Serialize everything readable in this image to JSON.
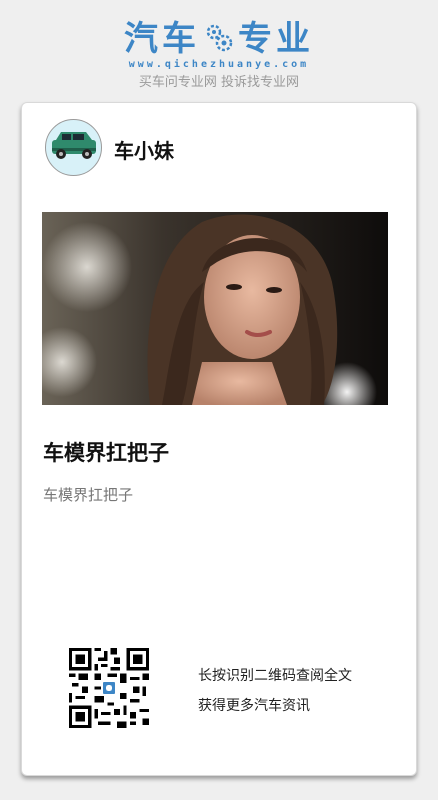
{
  "brand": {
    "title_left": "汽车",
    "title_right": "专业",
    "url": "www.qichezhuanye.com",
    "slogan": "买车问专业网 投诉找专业网",
    "color": "#3d86c6",
    "logo_icon": "gear-icon"
  },
  "author": {
    "name": "车小妹",
    "avatar_icon": "car-icon"
  },
  "article": {
    "title": "车模界扛把子",
    "summary": "车模界扛把子"
  },
  "qr": {
    "hint_line1": "长按识别二维码查阅全文",
    "hint_line2": "获得更多汽车资讯"
  }
}
